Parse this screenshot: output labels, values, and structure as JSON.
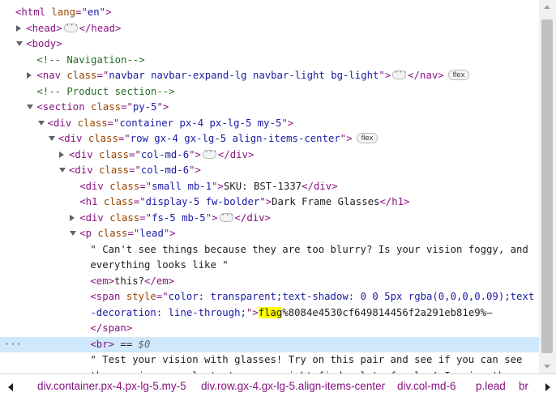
{
  "dom_tree": {
    "lines": [
      {
        "parts": [
          [
            "tag",
            "<html "
          ],
          [
            "an",
            "lang"
          ],
          [
            "tag",
            "=\""
          ],
          [
            "av",
            "en"
          ],
          [
            "tag",
            "\">"
          ]
        ]
      },
      {
        "parts": [
          [
            "tag",
            "<head>"
          ],
          [
            "ell",
            ""
          ],
          [
            "tag",
            "</head>"
          ]
        ]
      },
      {
        "parts": [
          [
            "tag",
            "<body>"
          ]
        ]
      },
      {
        "parts": [
          [
            "cm",
            "<!-- Navigation-->"
          ]
        ]
      },
      {
        "parts": [
          [
            "tag",
            "<nav "
          ],
          [
            "an",
            "class"
          ],
          [
            "tag",
            "=\""
          ],
          [
            "av",
            "navbar navbar-expand-lg navbar-light bg-light"
          ],
          [
            "tag",
            "\">"
          ],
          [
            "ell",
            ""
          ],
          [
            "tag",
            "</nav>"
          ],
          [
            "badge",
            "flex"
          ]
        ]
      },
      {
        "parts": [
          [
            "cm",
            "<!-- Product section-->"
          ]
        ]
      },
      {
        "parts": [
          [
            "tag",
            "<section "
          ],
          [
            "an",
            "class"
          ],
          [
            "tag",
            "=\""
          ],
          [
            "av",
            "py-5"
          ],
          [
            "tag",
            "\">"
          ]
        ]
      },
      {
        "parts": [
          [
            "tag",
            "<div "
          ],
          [
            "an",
            "class"
          ],
          [
            "tag",
            "=\""
          ],
          [
            "av",
            "container px-4 px-lg-5 my-5"
          ],
          [
            "tag",
            "\">"
          ]
        ]
      },
      {
        "parts": [
          [
            "tag",
            "<div "
          ],
          [
            "an",
            "class"
          ],
          [
            "tag",
            "=\""
          ],
          [
            "av",
            "row gx-4 gx-lg-5 align-items-center"
          ],
          [
            "tag",
            "\">"
          ],
          [
            "badge",
            "flex"
          ]
        ]
      },
      {
        "parts": [
          [
            "tag",
            "<div "
          ],
          [
            "an",
            "class"
          ],
          [
            "tag",
            "=\""
          ],
          [
            "av",
            "col-md-6"
          ],
          [
            "tag",
            "\">"
          ],
          [
            "ell",
            ""
          ],
          [
            "tag",
            "</div>"
          ]
        ]
      },
      {
        "parts": [
          [
            "tag",
            "<div "
          ],
          [
            "an",
            "class"
          ],
          [
            "tag",
            "=\""
          ],
          [
            "av",
            "col-md-6"
          ],
          [
            "tag",
            "\">"
          ]
        ]
      },
      {
        "parts": [
          [
            "tag",
            "<div "
          ],
          [
            "an",
            "class"
          ],
          [
            "tag",
            "=\""
          ],
          [
            "av",
            "small mb-1"
          ],
          [
            "tag",
            "\">"
          ],
          [
            "tt",
            "SKU: BST-1337"
          ],
          [
            "tag",
            "</div>"
          ]
        ]
      },
      {
        "parts": [
          [
            "tag",
            "<h1 "
          ],
          [
            "an",
            "class"
          ],
          [
            "tag",
            "=\""
          ],
          [
            "av",
            "display-5 fw-bolder"
          ],
          [
            "tag",
            "\">"
          ],
          [
            "tt",
            "Dark Frame Glasses"
          ],
          [
            "tag",
            "</h1>"
          ]
        ]
      },
      {
        "parts": [
          [
            "tag",
            "<div "
          ],
          [
            "an",
            "class"
          ],
          [
            "tag",
            "=\""
          ],
          [
            "av",
            "fs-5 mb-5"
          ],
          [
            "tag",
            "\">"
          ],
          [
            "ell",
            ""
          ],
          [
            "tag",
            "</div>"
          ]
        ]
      },
      {
        "parts": [
          [
            "tag",
            "<p "
          ],
          [
            "an",
            "class"
          ],
          [
            "tag",
            "=\""
          ],
          [
            "av",
            "lead"
          ],
          [
            "tag",
            "\">"
          ]
        ]
      },
      {
        "parts": [
          [
            "tt",
            "\" Can't see things because they are too blurry? Is your vision foggy, and"
          ]
        ]
      },
      {
        "parts": [
          [
            "tt",
            "everything looks like \""
          ]
        ]
      },
      {
        "parts": [
          [
            "tag",
            "<em>"
          ],
          [
            "tt",
            "this?"
          ],
          [
            "tag",
            "</em>"
          ]
        ]
      },
      {
        "parts": [
          [
            "tag",
            "<span "
          ],
          [
            "an",
            "style"
          ],
          [
            "tag",
            "=\""
          ],
          [
            "av",
            "color: transparent;text-shadow: 0 0 5px rgba(0,0,0,0.09);text"
          ]
        ]
      },
      {
        "parts": [
          [
            "av",
            "-decoration: line-through;"
          ],
          [
            "tag",
            "\">"
          ],
          [
            "hl",
            "flag"
          ],
          [
            "tt",
            "%8084e4530cf649814456f2a291eb81e9%—"
          ]
        ]
      },
      {
        "parts": [
          [
            "tag",
            "</span>"
          ]
        ]
      },
      {
        "parts": [
          [
            "tag",
            "<br>"
          ],
          [
            "tt",
            " == "
          ],
          [
            "dollar",
            "$0"
          ]
        ]
      },
      {
        "parts": [
          [
            "tt",
            "\" Test your vision with glasses! Try on this pair and see if you can see"
          ]
        ]
      },
      {
        "parts": [
          [
            "tt",
            "the previous sample text... you might find a lot of value! Imagine the"
          ]
        ]
      }
    ],
    "selected_gutter": "···"
  },
  "breadcrumb": {
    "items": [
      "div.container.px-4.px-lg-5.my-5",
      "div.row.gx-4.gx-lg-5.align-items-center",
      "div.col-md-6",
      "p.lead",
      "br"
    ]
  }
}
